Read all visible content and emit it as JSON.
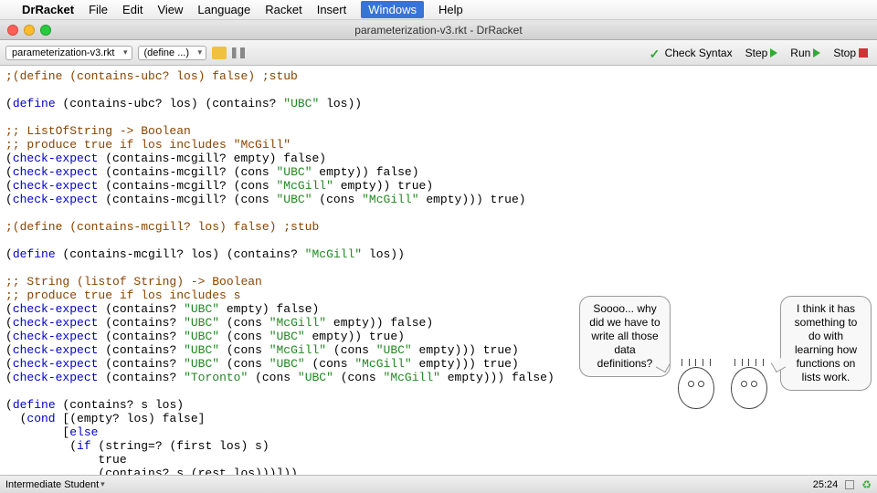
{
  "menubar": {
    "apple": "",
    "app": "DrRacket",
    "items": [
      "File",
      "Edit",
      "View",
      "Language",
      "Racket",
      "Insert",
      "Windows",
      "Help"
    ],
    "active_index": 6
  },
  "window": {
    "title": "parameterization-v3.rkt - DrRacket"
  },
  "toolbar": {
    "filename": "parameterization-v3.rkt",
    "define_menu": "(define ...)",
    "check_syntax": "Check Syntax",
    "step": "Step",
    "run": "Run",
    "stop": "Stop"
  },
  "code": {
    "lines": [
      {
        "t": "comment",
        "text": ";(define (contains-ubc? los) false) ;stub"
      },
      {
        "t": "blank"
      },
      {
        "t": "def",
        "pre": "(define (contains-ubc? los) (contains? ",
        "str": "\"UBC\"",
        "post": " los))"
      },
      {
        "t": "blank"
      },
      {
        "t": "comment",
        "text": ";; ListOfString -> Boolean"
      },
      {
        "t": "comment",
        "text": ";; produce true if los includes \"McGill\""
      },
      {
        "t": "check",
        "fn": "contains-mcgill?",
        "args_pre": "empty",
        "strs": [],
        "args_mid": "",
        "args_post": "",
        "result": "false"
      },
      {
        "t": "check",
        "fn": "contains-mcgill?",
        "args_pre": "(cons ",
        "strs": [
          "\"UBC\""
        ],
        "args_mid": " empty)",
        "args_post": "",
        "result": "false"
      },
      {
        "t": "check",
        "fn": "contains-mcgill?",
        "args_pre": "(cons ",
        "strs": [
          "\"McGill\""
        ],
        "args_mid": " empty)",
        "args_post": "",
        "result": "true"
      },
      {
        "t": "check",
        "fn": "contains-mcgill?",
        "args_pre": "(cons ",
        "strs": [
          "\"UBC\"",
          "\"McGill\""
        ],
        "args_mid": " (cons ",
        "args_post": " empty))",
        "result": "true"
      },
      {
        "t": "blank"
      },
      {
        "t": "comment",
        "text": ";(define (contains-mcgill? los) false) ;stub"
      },
      {
        "t": "blank"
      },
      {
        "t": "def",
        "pre": "(define (contains-mcgill? los) (contains? ",
        "str": "\"McGill\"",
        "post": " los))"
      },
      {
        "t": "blank"
      },
      {
        "t": "comment",
        "text": ";; String (listof String) -> Boolean"
      },
      {
        "t": "comment",
        "text": ";; produce true if los includes s"
      },
      {
        "t": "raw",
        "html": "(<span class='c-blue'>check-expect</span> (contains? <span class='c-green'>\"UBC\"</span> empty) false)"
      },
      {
        "t": "raw",
        "html": "(<span class='c-blue'>check-expect</span> (contains? <span class='c-green'>\"UBC\"</span> (cons <span class='c-green'>\"McGill\"</span> empty)) false)"
      },
      {
        "t": "raw",
        "html": "(<span class='c-blue'>check-expect</span> (contains? <span class='c-green'>\"UBC\"</span> (cons <span class='c-green'>\"UBC\"</span> empty)) true)"
      },
      {
        "t": "raw",
        "html": "(<span class='c-blue'>check-expect</span> (contains? <span class='c-green'>\"UBC\"</span> (cons <span class='c-green'>\"McGill\"</span> (cons <span class='c-green'>\"UBC\"</span> empty))) true)"
      },
      {
        "t": "raw",
        "html": "(<span class='c-blue'>check-expect</span> (contains? <span class='c-green'>\"UBC\"</span> (cons <span class='c-green'>\"UBC\"</span> (cons <span class='c-green'>\"McGill\"</span> empty))) true)"
      },
      {
        "t": "raw",
        "html": "(<span class='c-blue'>check-expect</span> (contains? <span class='c-green'>\"Toronto\"</span> (cons <span class='c-green'>\"UBC\"</span> (cons <span class='c-green'>\"McGill\"</span> empty))) false)"
      },
      {
        "t": "blank"
      },
      {
        "t": "raw",
        "html": "(<span class='c-blue'>define</span> (contains? s los)"
      },
      {
        "t": "raw",
        "html": "  (<span class='c-blue'>cond</span> [(empty? los) false]"
      },
      {
        "t": "raw",
        "html": "        [<span class='c-blue'>else</span>"
      },
      {
        "t": "raw",
        "html": "         (<span class='c-blue'>if</span> (string=? (first los) s)"
      },
      {
        "t": "raw",
        "html": "             true"
      },
      {
        "t": "raw",
        "html": "             (contains? s (rest los)))]))"
      }
    ]
  },
  "bubbles": {
    "b1": "Soooo... why did we have to write all those data definitions?",
    "b2": "I think it has something to do with learning how functions on lists work."
  },
  "statusbar": {
    "language": "Intermediate Student",
    "position": "25:24"
  }
}
